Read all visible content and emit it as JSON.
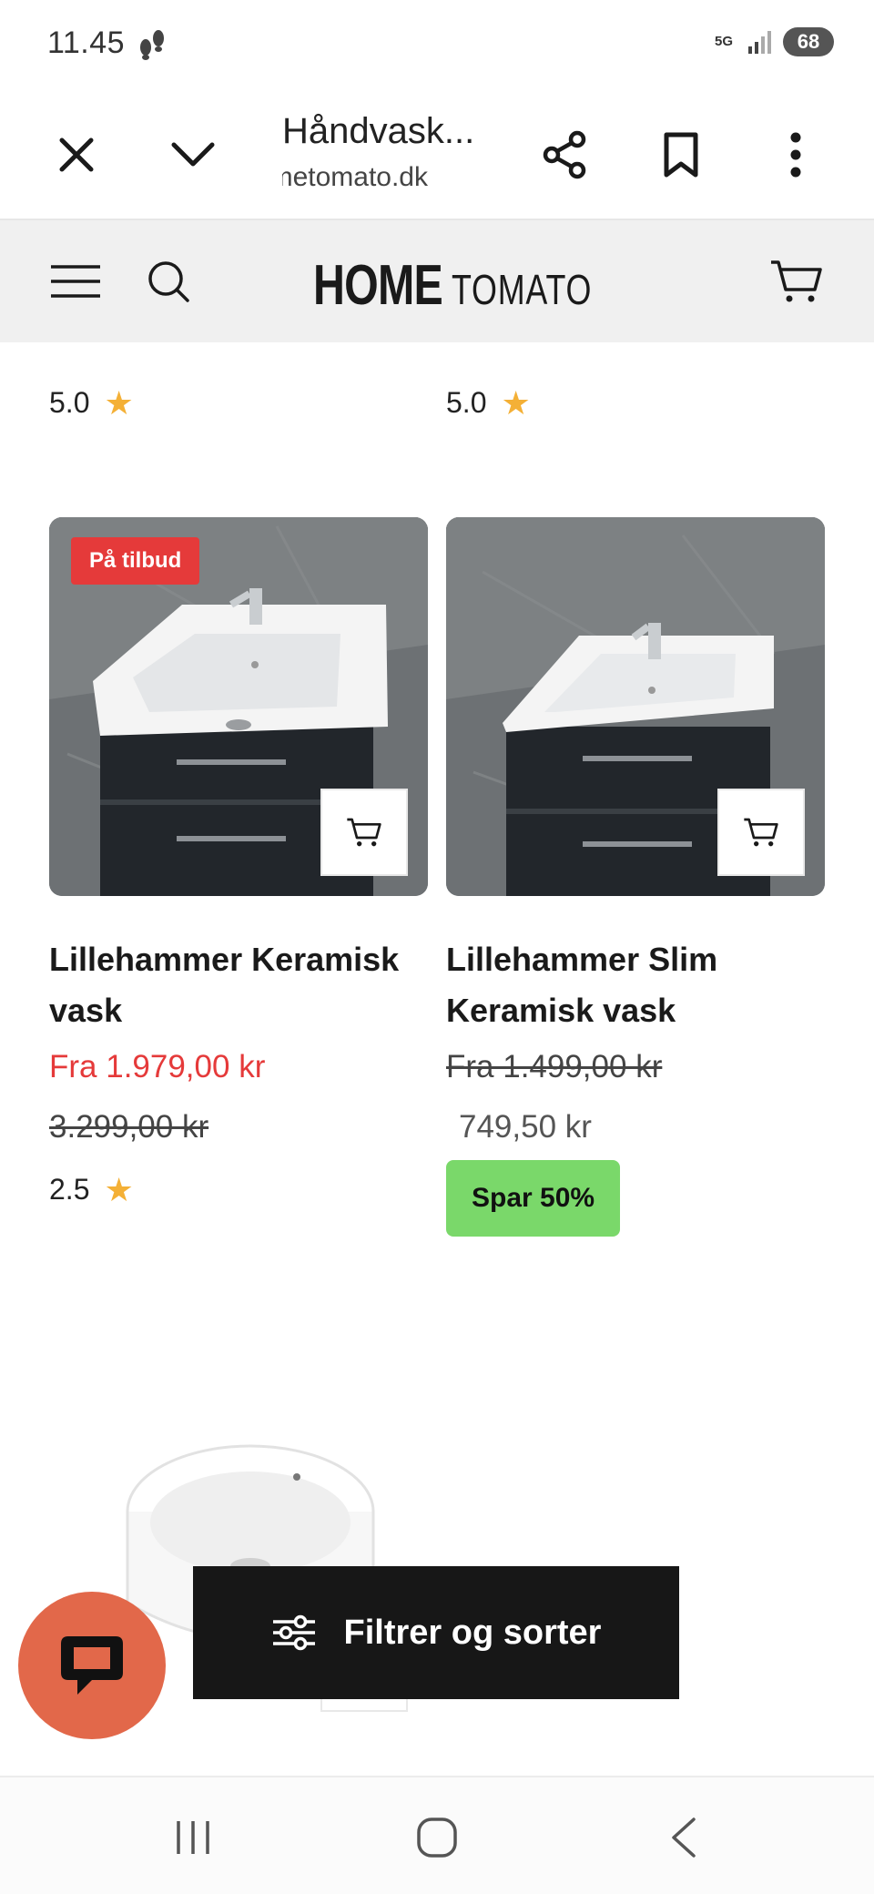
{
  "status_bar": {
    "time": "11.45",
    "network": "5G",
    "battery": "68"
  },
  "browser": {
    "title": "Håndvask...",
    "url": "hometomato.dk"
  },
  "site": {
    "logo_home": "HOME",
    "logo_tomato": "TOMATO"
  },
  "top_ratings": [
    {
      "value": "5.0"
    },
    {
      "value": "5.0"
    }
  ],
  "products": [
    {
      "badge": "På tilbud",
      "title": "Lillehammer Keramisk vask",
      "price_current": "Fra 1.979,00 kr",
      "price_old": "3.299,00 kr",
      "rating": "2.5"
    },
    {
      "title": "Lillehammer Slim Keramisk vask",
      "price_old": "Fra 1.499,00 kr",
      "price_current": "749,50 kr",
      "save_label": "Spar 50%"
    }
  ],
  "filter": {
    "label": "Filtrer og sorter"
  },
  "colors": {
    "accent_red": "#e53a3a",
    "save_green": "#7ad86a",
    "star": "#f4b036",
    "chat": "#e2684a"
  },
  "icons": [
    "close-icon",
    "chevron-down-icon",
    "share-icon",
    "bookmark-icon",
    "more-vertical-icon",
    "menu-icon",
    "search-icon",
    "cart-icon",
    "star-icon",
    "filter-sliders-icon",
    "chat-icon",
    "recent-apps-icon",
    "home-icon",
    "back-icon"
  ]
}
